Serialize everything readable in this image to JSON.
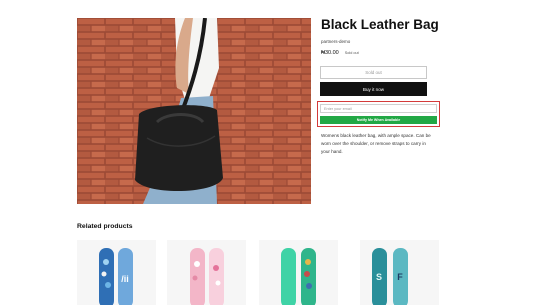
{
  "product": {
    "title": "Black Leather Bag",
    "vendor": "partners-demo",
    "price": "₦30.00",
    "badge": "Sold out",
    "description": "Womens black leather bag, with ample space. Can be worn over the shoulder, or remove straps to carry in your hand.",
    "image_icon": "product-photo"
  },
  "buttons": {
    "sold_out": "Sold out",
    "buy_now": "Buy it now",
    "notify": "Notify Me When Available"
  },
  "notify_form": {
    "email_placeholder": "Enter your email"
  },
  "related": {
    "heading": "Related products",
    "items": [
      {
        "name": "snowboard-blue-dots"
      },
      {
        "name": "snowboard-pink-floral"
      },
      {
        "name": "snowboard-mint-characters"
      },
      {
        "name": "snowboard-teal-graphic"
      }
    ]
  },
  "colors": {
    "accent_green": "#22a845",
    "highlight_red": "#d43a3a",
    "buy_black": "#111111"
  }
}
